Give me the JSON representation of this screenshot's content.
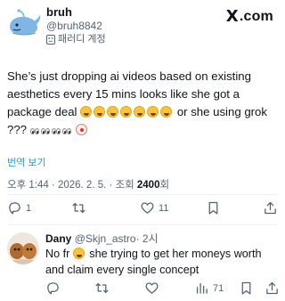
{
  "header": {
    "display_name": "bruh",
    "handle": "@bruh8842",
    "account_label": "패러디 계정",
    "logo_text": ".com",
    "logo_letter": "X"
  },
  "tweet": {
    "text_1": "She’s just dropping ai videos based on existing aesthetics every 15 mins looks like she got a package deal",
    "text_2": "or she using grok ???",
    "translate_label": "번역 보기",
    "time_date": "오후 1:44 · 2026. 2. 5. · 조회 ",
    "views": "2400",
    "views_suffix": "회"
  },
  "tweet_actions": {
    "reply_count": "1",
    "like_count": "11"
  },
  "reply": {
    "name": "Dany",
    "handle": "@Skjn_astro",
    "time": "· 2시",
    "text_1": "No fr",
    "text_2": "she trying to get her moneys worth and claim every single concept",
    "views_count": "71"
  },
  "icons": {
    "reply": "reply-icon",
    "retweet": "retweet-icon",
    "like": "heart-icon",
    "views": "views-icon",
    "bookmark": "bookmark-icon",
    "share": "share-icon"
  },
  "colors": {
    "link": "#1d9bf0",
    "secondary_text": "#536471",
    "primary_text": "#0f1419"
  }
}
